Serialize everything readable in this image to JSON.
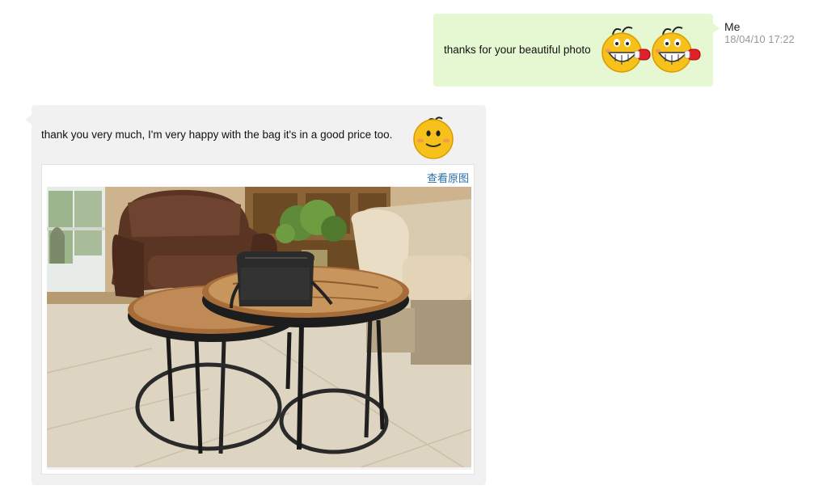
{
  "outgoing": {
    "text": "thanks for your beautiful photo",
    "sender": "Me",
    "timestamp": "18/04/10 17:22",
    "emoticons": [
      "boxing-grin-emoticon",
      "boxing-grin-emoticon"
    ]
  },
  "incoming": {
    "text": "thank you very much, I'm very happy with the bag it's in a good price too.",
    "emoticons": [
      "smile-emoticon"
    ],
    "view_original_label": "查看原图"
  },
  "colors": {
    "outgoing_bubble": "#e6f8d2",
    "incoming_bubble": "#f1f1f1",
    "link": "#2a6fa8",
    "timestamp": "#999999"
  }
}
